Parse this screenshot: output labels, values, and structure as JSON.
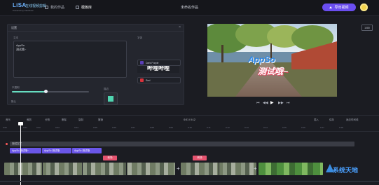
{
  "app": {
    "logo_text": "LiSA",
    "logo_brand": "在线视频剪辑",
    "logo_sub": "Powered by JianShow",
    "nav": [
      {
        "label": "我的作品",
        "icon": "folder-icon"
      },
      {
        "label": "模板库",
        "icon": "template-icon"
      }
    ],
    "title": "未命名作品",
    "export_label": "导出视频"
  },
  "settings_panel": {
    "tab": "设置",
    "text_label": "文本",
    "text_lines": [
      "AppSo",
      "测试哦~"
    ],
    "opacity_label": "不透明",
    "opacity_value": 0.4,
    "color_label": "描边",
    "style_label": "字体",
    "style_preview": "哔哩哔哩",
    "font_color_name": "Dark Purple",
    "font_color_hex": "#5b3fb8",
    "stroke_color_name": "Red",
    "stroke_color_hex": "#d8323b",
    "bottom_label": "默认"
  },
  "preview": {
    "quality_badge": "1080",
    "overlay_line1": "AppSo",
    "overlay_line2": "测试哦~"
  },
  "controls": {
    "rewind": "⏮",
    "back": "◀◀",
    "play": "▶",
    "forward": "▶▶",
    "end": "⏭"
  },
  "timeline": {
    "tools": [
      "音乐",
      "裁剪",
      "分割",
      "删除",
      "复制",
      "撤销"
    ],
    "right_tools": [
      "插入",
      "保存",
      "适应时间线"
    ],
    "timecode": "0:01 / 0:12",
    "ticks": [
      "0:00",
      "0:01",
      "0:02",
      "0:03",
      "0:04",
      "0:05",
      "0:06",
      "0:07",
      "0:08",
      "0:09",
      "0:10",
      "0:11",
      "0:12",
      "0:13",
      "0:14",
      "0:15",
      "0:16",
      "0:17",
      "0:18"
    ],
    "text_track_label": "测试文字",
    "text_clips": [
      "AppSo 测试哦~",
      "AppSo 测试哦",
      "AppSo 测试哦"
    ],
    "markers": [
      "转场",
      "转场"
    ],
    "add_label": "+",
    "watermark": "系统天地"
  }
}
